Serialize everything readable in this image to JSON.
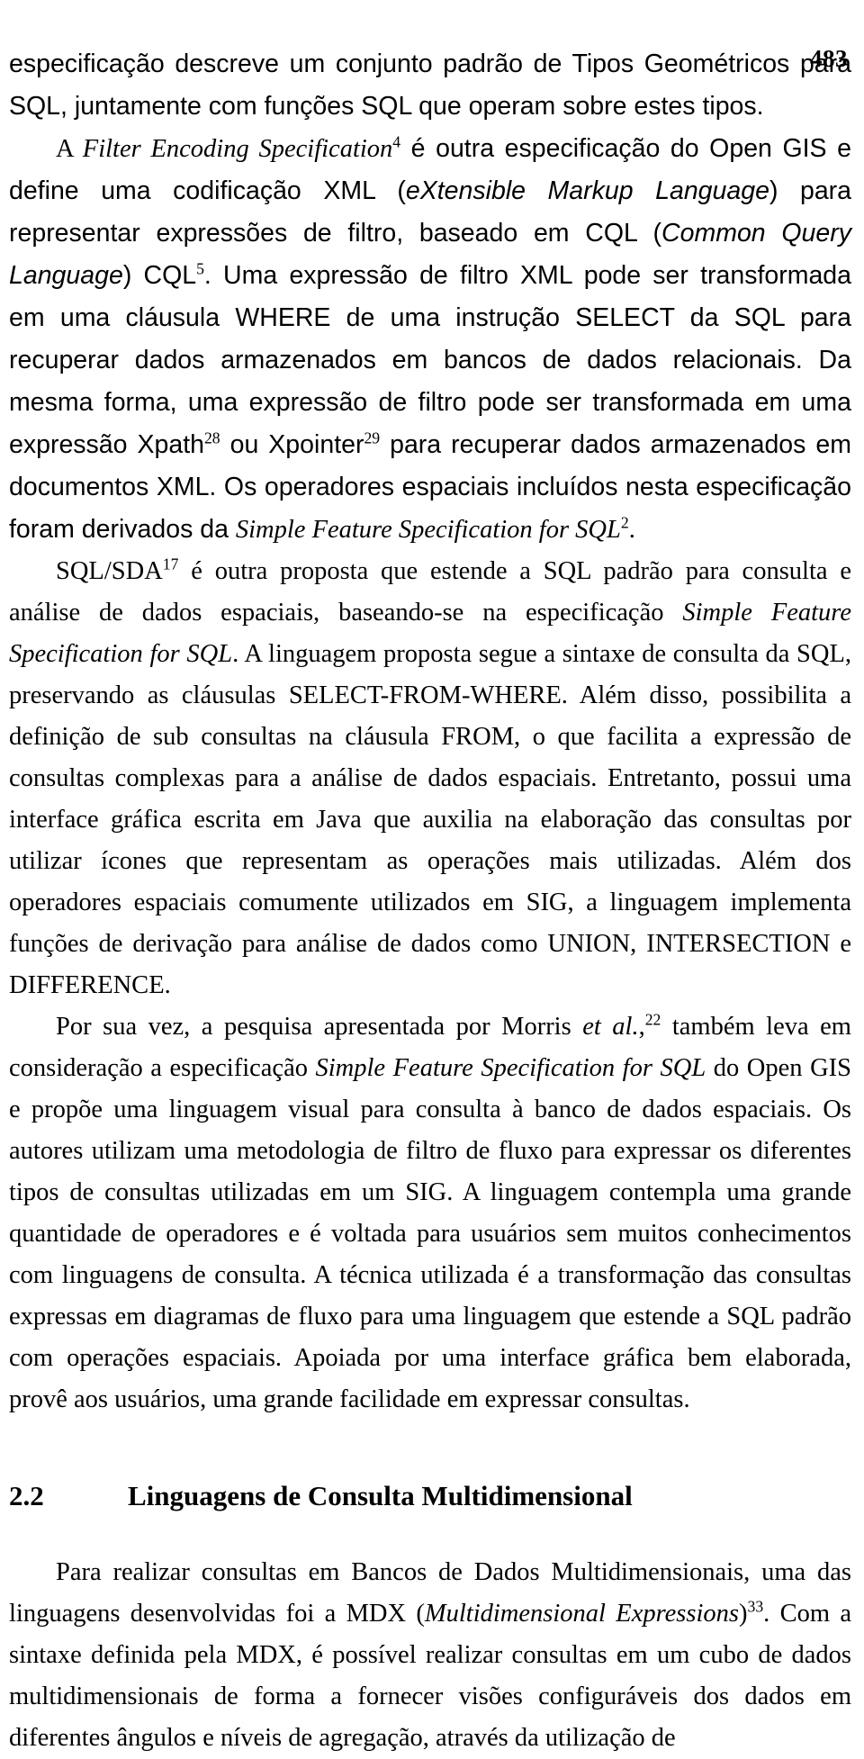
{
  "document": {
    "page_number": "483",
    "language": "pt-BR",
    "paragraphs": [
      {
        "id": "p1",
        "indent": false,
        "runs": [
          {
            "text": "especificação descreve um conjunto padrão de Tipos Geométricos para SQL, juntamente com funções SQL que operam sobre estes tipos.",
            "style": "normal"
          }
        ]
      },
      {
        "id": "p2",
        "indent": true,
        "runs": [
          {
            "text": "A ",
            "style": "normal"
          },
          {
            "text": "Filter Encoding Specification",
            "style": "italic"
          },
          {
            "text": "4",
            "style": "superscript"
          },
          {
            "text": " é outra especificação do Open GIS e define uma codificação XML (",
            "style": "normal"
          },
          {
            "text": "eXtensible Markup Language",
            "style": "italic"
          },
          {
            "text": ") para representar expressões de filtro, baseado em CQL (",
            "style": "normal"
          },
          {
            "text": "Common Query Language",
            "style": "italic"
          },
          {
            "text": ") CQL",
            "style": "normal"
          },
          {
            "text": "5",
            "style": "superscript"
          },
          {
            "text": ". Uma expressão de filtro XML pode ser transformada em uma cláusula WHERE de uma instrução SELECT da SQL para recuperar dados armazenados em bancos de dados relacionais. Da mesma forma, uma expressão de filtro pode ser transformada em uma expressão Xpath",
            "style": "normal"
          },
          {
            "text": "28",
            "style": "superscript"
          },
          {
            "text": " ou Xpointer",
            "style": "normal"
          },
          {
            "text": "29",
            "style": "superscript"
          },
          {
            "text": " para recuperar dados armazenados em documentos XML. Os operadores espaciais incluídos nesta especificação foram derivados da ",
            "style": "normal"
          },
          {
            "text": "Simple Feature Specification for SQL",
            "style": "italic"
          },
          {
            "text": "2",
            "style": "superscript"
          },
          {
            "text": ".",
            "style": "normal"
          }
        ]
      },
      {
        "id": "p3",
        "indent": true,
        "runs": [
          {
            "text": "SQL/SDA",
            "style": "normal"
          },
          {
            "text": "17",
            "style": "superscript"
          },
          {
            "text": " é outra proposta que estende a SQL padrão para consulta e análise de dados espaciais, baseando-se na especificação ",
            "style": "normal"
          },
          {
            "text": "Simple Feature Specification for SQL",
            "style": "italic"
          },
          {
            "text": ". A linguagem proposta segue a sintaxe de consulta da SQL, preservando as cláusulas SELECT-FROM-WHERE. Além disso, possibilita a definição de sub consultas na cláusula FROM, o que facilita a expressão de consultas complexas para a análise de dados espaciais. Entretanto, possui uma interface gráfica escrita em Java que auxilia na elaboração das consultas por utilizar ícones que representam as operações mais utilizadas. Além dos operadores espaciais comumente utilizados em SIG, a linguagem implementa funções de derivação para análise de dados como UNION, INTERSECTION e DIFFERENCE.",
            "style": "normal"
          }
        ]
      },
      {
        "id": "p4",
        "indent": true,
        "runs": [
          {
            "text": "Por sua vez, a pesquisa apresentada por Morris ",
            "style": "normal"
          },
          {
            "text": "et al.",
            "style": "italic"
          },
          {
            "text": ",",
            "style": "normal"
          },
          {
            "text": "22",
            "style": "superscript"
          },
          {
            "text": " também leva em consideração a especificação ",
            "style": "normal"
          },
          {
            "text": "Simple Feature Specification for SQL",
            "style": "italic"
          },
          {
            "text": " do Open GIS e propõe uma linguagem visual para consulta à banco de dados espaciais. Os autores utilizam uma metodologia de filtro de fluxo para expressar os diferentes tipos de consultas utilizadas em um SIG. A linguagem contempla uma grande quantidade de operadores e é voltada para usuários sem muitos conhecimentos com linguagens de consulta. A técnica utilizada é a transformação das consultas expressas em diagramas de fluxo para uma linguagem que estende a SQL padrão com operações espaciais. Apoiada por uma interface gráfica bem elaborada, provê aos usuários, uma grande facilidade em expressar consultas.",
            "style": "normal"
          }
        ]
      },
      {
        "id": "p5",
        "indent": true,
        "runs": [
          {
            "text": "Para realizar consultas em Bancos de Dados Multidimensionais, uma das linguagens desenvolvidas foi a MDX (",
            "style": "normal"
          },
          {
            "text": "Multidimensional Expressions",
            "style": "italic"
          },
          {
            "text": ")",
            "style": "normal"
          },
          {
            "text": "33",
            "style": "superscript"
          },
          {
            "text": ". Com a sintaxe definida pela MDX, é possível realizar consultas em um cubo de dados multidimensionais de forma a fornecer visões configuráveis dos dados em diferentes ângulos e níveis de agregação, através da utilização de",
            "style": "normal"
          }
        ]
      }
    ],
    "section": {
      "number": "2.2",
      "title": "Linguagens de Consulta Multidimensional"
    }
  }
}
